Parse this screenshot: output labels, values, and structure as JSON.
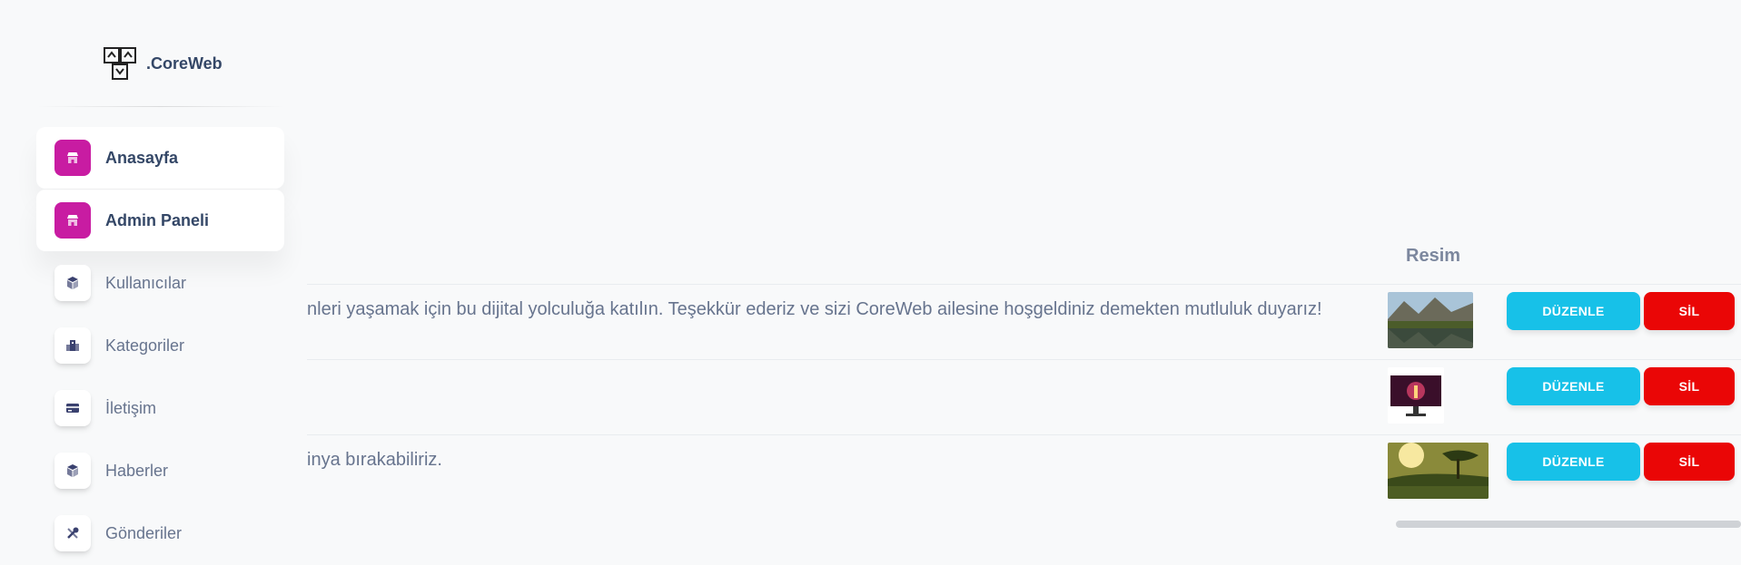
{
  "brand": {
    "name": ".CoreWeb"
  },
  "sidebar": {
    "items": [
      {
        "label": "Anasayfa",
        "icon": "shop-icon",
        "active": true
      },
      {
        "label": "Admin Paneli",
        "icon": "shop-icon",
        "active": true
      },
      {
        "label": "Kullanıcılar",
        "icon": "cube-icon",
        "active": false
      },
      {
        "label": "Kategoriler",
        "icon": "office-icon",
        "active": false
      },
      {
        "label": "İletişim",
        "icon": "credit-card-icon",
        "active": false
      },
      {
        "label": "Haberler",
        "icon": "cube-icon",
        "active": false
      },
      {
        "label": "Gönderiler",
        "icon": "tools-icon",
        "active": false
      }
    ]
  },
  "table": {
    "header_image": "Resim",
    "rows": [
      {
        "text": "nleri yaşamak için bu dijital yolculuğa katılın. Teşekkür ederiz ve sizi CoreWeb ailesine hoşgeldiniz demekten mutluluk duyarız!",
        "image": "landscape-lake-thumbnail",
        "edit": "DÜZENLE",
        "delete": "SİL"
      },
      {
        "text": "",
        "image": "monitor-thumbnail",
        "edit": "DÜZENLE",
        "delete": "SİL"
      },
      {
        "text": "inya bırakabiliriz.",
        "image": "forest-sunrise-thumbnail",
        "edit": "DÜZENLE",
        "delete": "SİL"
      }
    ]
  },
  "colors": {
    "accent": "#c81ca2",
    "edit": "#17c1e8",
    "delete": "#ea0606",
    "text": "#67748e",
    "heading": "#344767"
  }
}
